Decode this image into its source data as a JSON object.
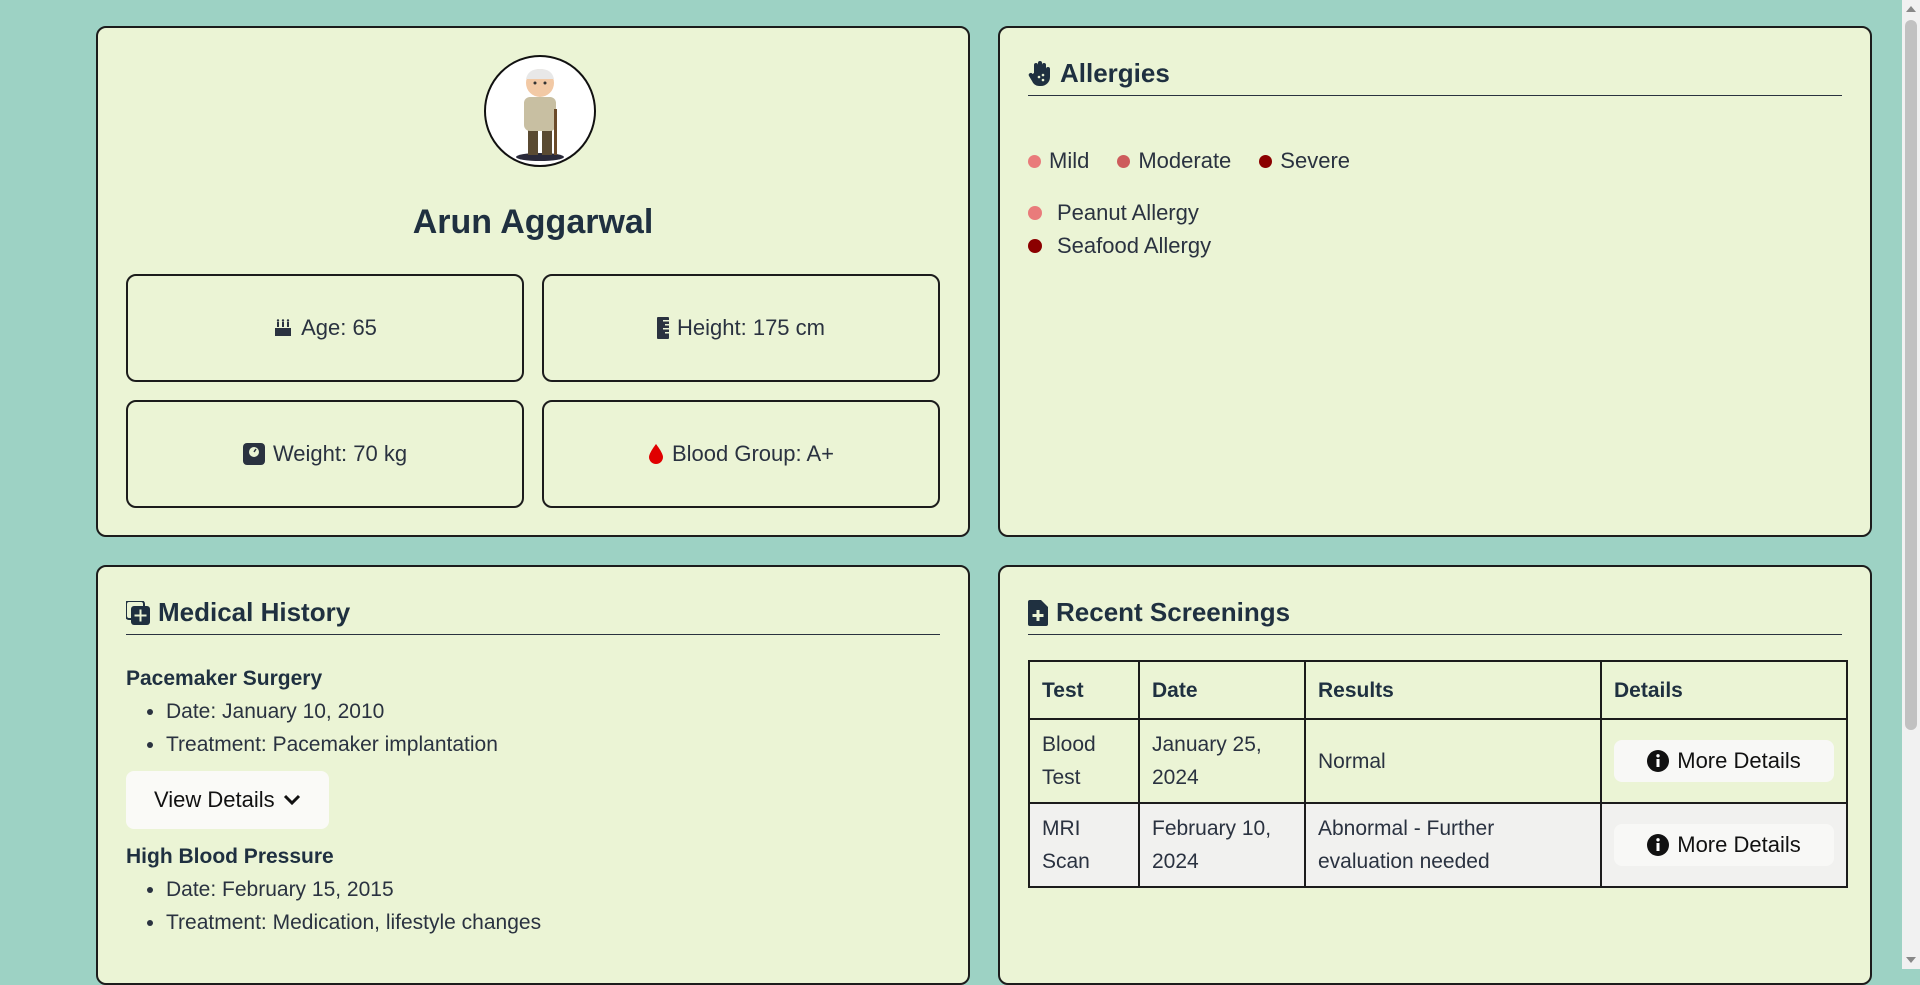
{
  "profile": {
    "name": "Arun Aggarwal",
    "stats": {
      "age": "Age: 65",
      "height": "Height: 175 cm",
      "weight": "Weight: 70 kg",
      "blood": "Blood Group: A+"
    }
  },
  "allergies": {
    "title": "Allergies",
    "legend": [
      {
        "label": "Mild",
        "color": "#e97b7b"
      },
      {
        "label": "Moderate",
        "color": "#cd5c5c"
      },
      {
        "label": "Severe",
        "color": "#8b0000"
      }
    ],
    "items": [
      {
        "label": "Peanut Allergy",
        "color": "#e97b7b"
      },
      {
        "label": "Seafood Allergy",
        "color": "#8b0000"
      }
    ]
  },
  "history": {
    "title": "Medical History",
    "conditions": [
      {
        "title": "Pacemaker Surgery",
        "date": "Date: January 10, 2010",
        "treatment": "Treatment: Pacemaker implantation",
        "button": "View Details"
      },
      {
        "title": "High Blood Pressure",
        "date": "Date: February 15, 2015",
        "treatment": "Treatment: Medication, lifestyle changes"
      }
    ]
  },
  "screenings": {
    "title": "Recent Screenings",
    "headers": [
      "Test",
      "Date",
      "Results",
      "Details"
    ],
    "rows": [
      {
        "test": "Blood Test",
        "date": "January 25, 2024",
        "result": "Normal",
        "button": "More Details"
      },
      {
        "test": "MRI Scan",
        "date": "February 10, 2024",
        "result": "Abnormal - Further evaluation needed",
        "button": "More Details"
      }
    ]
  },
  "colors": {
    "background": "#9dd2c4",
    "card": "#ebf4d5",
    "blood_icon": "#e00000"
  }
}
